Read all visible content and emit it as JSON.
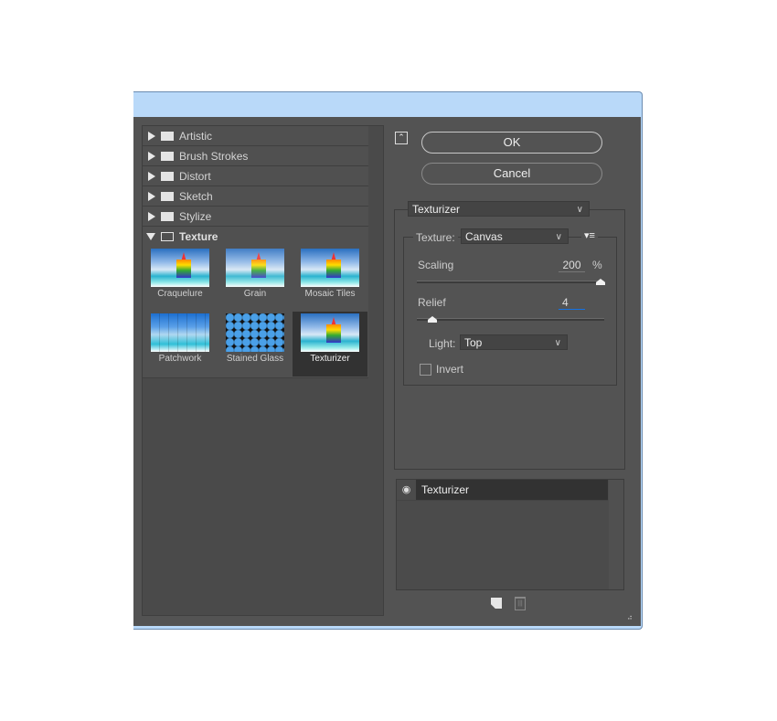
{
  "categories": [
    {
      "label": "Artistic"
    },
    {
      "label": "Brush Strokes"
    },
    {
      "label": "Distort"
    },
    {
      "label": "Sketch"
    },
    {
      "label": "Stylize"
    },
    {
      "label": "Texture",
      "expanded": true
    }
  ],
  "filters": [
    {
      "label": "Craquelure"
    },
    {
      "label": "Grain"
    },
    {
      "label": "Mosaic Tiles"
    },
    {
      "label": "Patchwork"
    },
    {
      "label": "Stained Glass"
    },
    {
      "label": "Texturizer",
      "selected": true
    }
  ],
  "buttons": {
    "ok": "OK",
    "cancel": "Cancel"
  },
  "filter_select": "Texturizer",
  "settings": {
    "texture_label": "Texture:",
    "texture_value": "Canvas",
    "scaling_label": "Scaling",
    "scaling_value": "200",
    "scaling_unit": "%",
    "scaling_fraction": 1.0,
    "relief_label": "Relief",
    "relief_value": "4",
    "relief_fraction": 0.08,
    "light_label": "Light:",
    "light_value": "Top",
    "invert_label": "Invert",
    "invert_checked": false
  },
  "layers": [
    {
      "label": "Texturizer",
      "visible": true
    }
  ],
  "colors": {
    "panel": "#535353",
    "titlebar": "#b9d9f9",
    "selected": "#323232",
    "focus": "#1473e6"
  }
}
